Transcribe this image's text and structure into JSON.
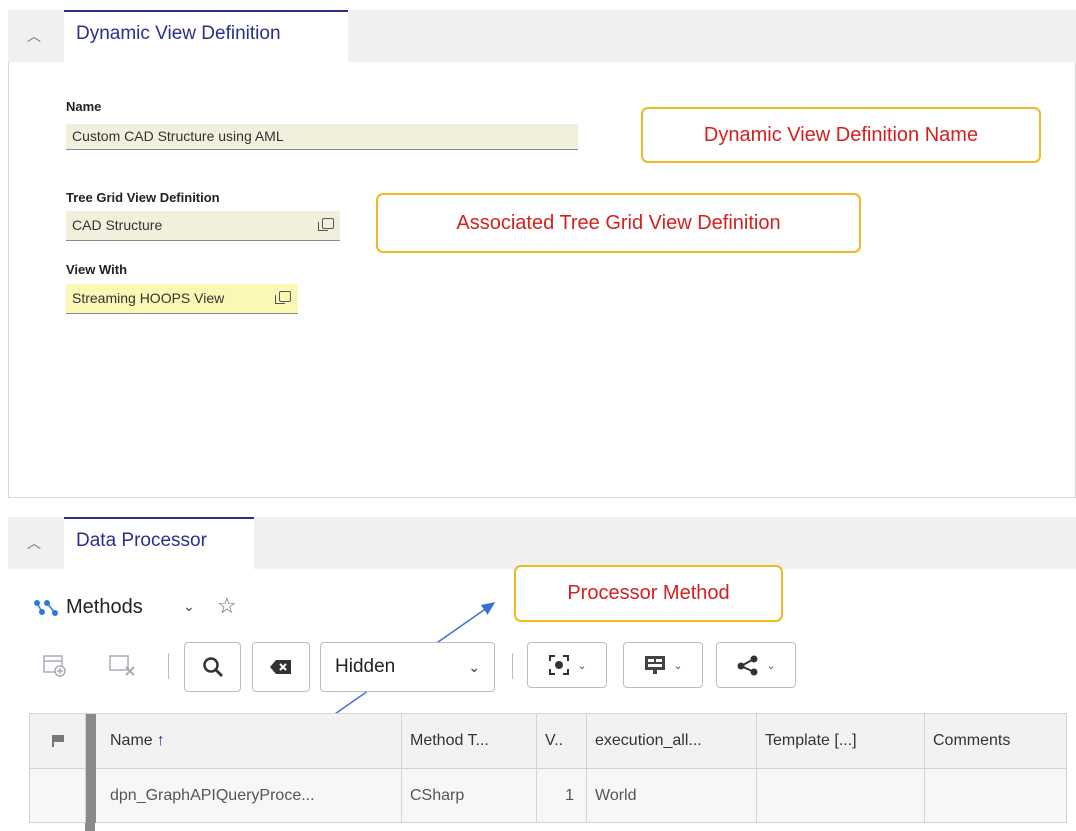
{
  "sections": {
    "definition": {
      "title": "Dynamic View Definition"
    },
    "processor": {
      "title": "Data Processor"
    }
  },
  "form": {
    "name": {
      "label": "Name",
      "value": "Custom CAD Structure using AML"
    },
    "tree_grid": {
      "label": "Tree Grid View Definition",
      "value": "CAD Structure"
    },
    "view_with": {
      "label": "View With",
      "value": "Streaming HOOPS View"
    }
  },
  "callouts": {
    "name": "Dynamic View Definition Name",
    "tree_grid": "Associated Tree Grid View Definition",
    "method": "Processor Method"
  },
  "methods": {
    "title": "Methods",
    "filter_value": "Hidden"
  },
  "grid": {
    "columns": [
      "Name",
      "Method T...",
      "V..",
      "execution_all...",
      "Template [...]",
      "Comments"
    ],
    "sort_indicator": "↑",
    "rows": [
      [
        "dpn_GraphAPIQueryProce...",
        "CSharp",
        "1",
        "World",
        "",
        ""
      ]
    ]
  },
  "colors": {
    "accent": "#2b2f8c",
    "callout_border": "#f2b822",
    "callout_text": "#d42020",
    "arrow": "#3b6fd1",
    "field_bg": "#f2f0dc"
  },
  "icons": [
    "chevron-up-icon",
    "open-item-icon",
    "methods-icon",
    "chevron-down-icon",
    "star-icon",
    "new-item-icon",
    "delete-item-icon",
    "search-icon",
    "clear-icon",
    "focus-icon",
    "layout-icon",
    "share-icon",
    "flag-icon"
  ]
}
